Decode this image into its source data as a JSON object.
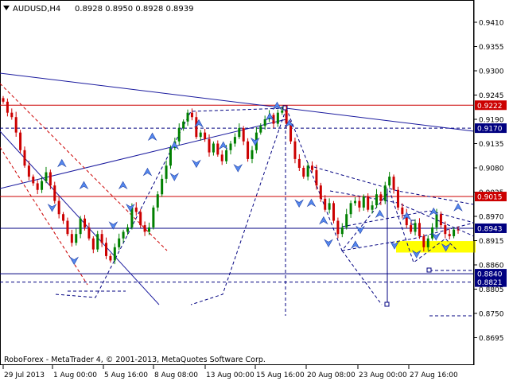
{
  "window": {
    "symbol_title": "AUDUSD,H4",
    "ohlc": "0.8928 0.8950 0.8928 0.8939",
    "copyright": "RoboForex - MetaTrader 4, © 2001-2013, MetaQuotes Software Corp."
  },
  "colors": {
    "background": "#ffffff",
    "bull_candle": "#008000",
    "bear_candle": "#cc0000",
    "forecast": "#000080",
    "support_resistance": "#cc0000",
    "trendline": "#1a1a9e",
    "target_zone": "#ffff00",
    "arrow": "#5588ee"
  },
  "chart_data": {
    "type": "candlestick",
    "timeframe": "H4",
    "x_tick_labels": [
      "29 Jul 2013",
      "1 Aug 00:00",
      "5 Aug 16:00",
      "8 Aug 08:00",
      "13 Aug 00:00",
      "15 Aug 16:00",
      "20 Aug 08:00",
      "23 Aug 00:00",
      "27 Aug 16:00"
    ],
    "y_tick_labels": [
      "0.9410",
      "0.9355",
      "0.9300",
      "0.9245",
      "0.9190",
      "0.9135",
      "0.9080",
      "0.9025",
      "0.8970",
      "0.8915",
      "0.8860",
      "0.8805",
      "0.8750",
      "0.8695"
    ],
    "ylim": [
      0.869,
      0.9425
    ],
    "grid": false,
    "closes": [
      0.923,
      0.9205,
      0.9195,
      0.916,
      0.912,
      0.9085,
      0.906,
      0.9045,
      0.903,
      0.905,
      0.907,
      0.904,
      0.9005,
      0.8975,
      0.896,
      0.893,
      0.891,
      0.893,
      0.8965,
      0.8945,
      0.892,
      0.8895,
      0.893,
      0.891,
      0.888,
      0.887,
      0.89,
      0.892,
      0.8935,
      0.8945,
      0.899,
      0.898,
      0.895,
      0.8935,
      0.8945,
      0.899,
      0.902,
      0.9055,
      0.9085,
      0.9125,
      0.914,
      0.917,
      0.9185,
      0.9205,
      0.9195,
      0.915,
      0.916,
      0.9145,
      0.9115,
      0.9135,
      0.911,
      0.9095,
      0.912,
      0.9135,
      0.915,
      0.917,
      0.914,
      0.91,
      0.912,
      0.916,
      0.9175,
      0.919,
      0.92,
      0.918,
      0.9205,
      0.921,
      0.918,
      0.914,
      0.91,
      0.908,
      0.906,
      0.9085,
      0.9075,
      0.904,
      0.901,
      0.8985,
      0.9,
      0.896,
      0.893,
      0.8945,
      0.8975,
      0.9,
      0.9005,
      0.899,
      0.9015,
      0.8985,
      0.8995,
      0.902,
      0.9005,
      0.904,
      0.906,
      0.903,
      0.899,
      0.8975,
      0.895,
      0.8935,
      0.8955,
      0.8925,
      0.89,
      0.892,
      0.8945,
      0.8975,
      0.895,
      0.893,
      0.8925,
      0.894,
      0.8939
    ],
    "levels": [
      {
        "label": "0.9222",
        "price": 0.9222,
        "style": "solid",
        "color": "#cc0000"
      },
      {
        "label": "0.9170",
        "price": 0.917,
        "style": "dashed",
        "color": "#000080"
      },
      {
        "label": "0.9015",
        "price": 0.9015,
        "style": "solid",
        "color": "#cc0000"
      },
      {
        "label": "0.8943",
        "price": 0.8943,
        "style": "solid",
        "color": "#000080"
      },
      {
        "label": "0.8840",
        "price": 0.884,
        "style": "solid",
        "color": "#000080"
      },
      {
        "label": "0.8821",
        "price": 0.8821,
        "style": "dashed",
        "color": "#000080"
      }
    ],
    "target_zone": {
      "from": 0.8888,
      "to": 0.8914
    },
    "arrow_marks_up": [
      [
        24,
        0.909
      ],
      [
        33,
        0.904
      ],
      [
        49,
        0.904
      ],
      [
        59,
        0.907
      ],
      [
        61,
        0.915
      ],
      [
        70,
        0.913
      ],
      [
        80,
        0.918
      ],
      [
        90,
        0.913
      ],
      [
        109,
        0.9195
      ],
      [
        112,
        0.922
      ],
      [
        117,
        0.918
      ],
      [
        126,
        0.9
      ],
      [
        131,
        0.896
      ],
      [
        144,
        0.8905
      ],
      [
        154,
        0.8975
      ],
      [
        165,
        0.897
      ],
      [
        176,
        0.898
      ],
      [
        186,
        0.899
      ]
    ],
    "arrow_marks_down": [
      [
        20,
        0.899
      ],
      [
        29,
        0.887
      ],
      [
        45,
        0.895
      ],
      [
        52,
        0.899
      ],
      [
        70,
        0.906
      ],
      [
        79,
        0.909
      ],
      [
        96,
        0.908
      ],
      [
        103,
        0.914
      ],
      [
        121,
        0.9
      ],
      [
        133,
        0.891
      ],
      [
        146,
        0.894
      ],
      [
        160,
        0.8905
      ],
      [
        169,
        0.8885
      ],
      [
        177,
        0.8925
      ],
      [
        181,
        0.89
      ]
    ]
  }
}
